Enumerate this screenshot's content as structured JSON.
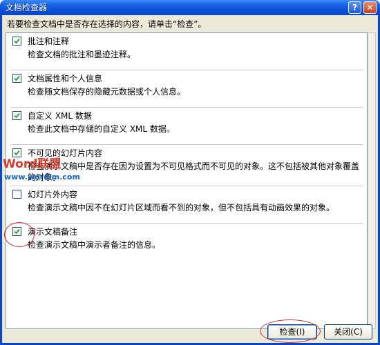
{
  "window": {
    "title": "文档检查器"
  },
  "titlebar_buttons": {
    "help": "?",
    "close": "✕"
  },
  "instruction": "若要检查文档中是否存在选择的内容，请单击“检查”。",
  "items": [
    {
      "title": "批注和注释",
      "description": "检查文档的批注和墨迹注释。",
      "checked": true
    },
    {
      "title": "文档属性和个人信息",
      "description": "检查随文档保存的隐藏元数据或个人信息。",
      "checked": true
    },
    {
      "title": "自定义 XML 数据",
      "description": "检查此文档中存储的自定义 XML 数据。",
      "checked": true
    },
    {
      "title": "不可见的幻灯片内容",
      "description": "检查演示文稿中是否存在因为设置为不可见格式而不可见的对象。这不包括被其他对象覆盖的对象。",
      "checked": true
    },
    {
      "title": "幻灯片外内容",
      "description": "检查演示文稿中因不在幻灯片区域而看不到的对象，但不包括具有动画效果的对象。",
      "checked": false
    },
    {
      "title": "演示文稿备注",
      "description": "检查演示文稿中演示者备注的信息。",
      "checked": true
    }
  ],
  "buttons": {
    "inspect": "检查(I)",
    "close": "关闭(C)"
  },
  "watermark": {
    "main": "Word联盟",
    "url": "www.wordlm.com"
  },
  "colors": {
    "title_bar": "#0b4fd6",
    "dialog_bg": "#ece9d8",
    "annotation": "#d43030"
  }
}
